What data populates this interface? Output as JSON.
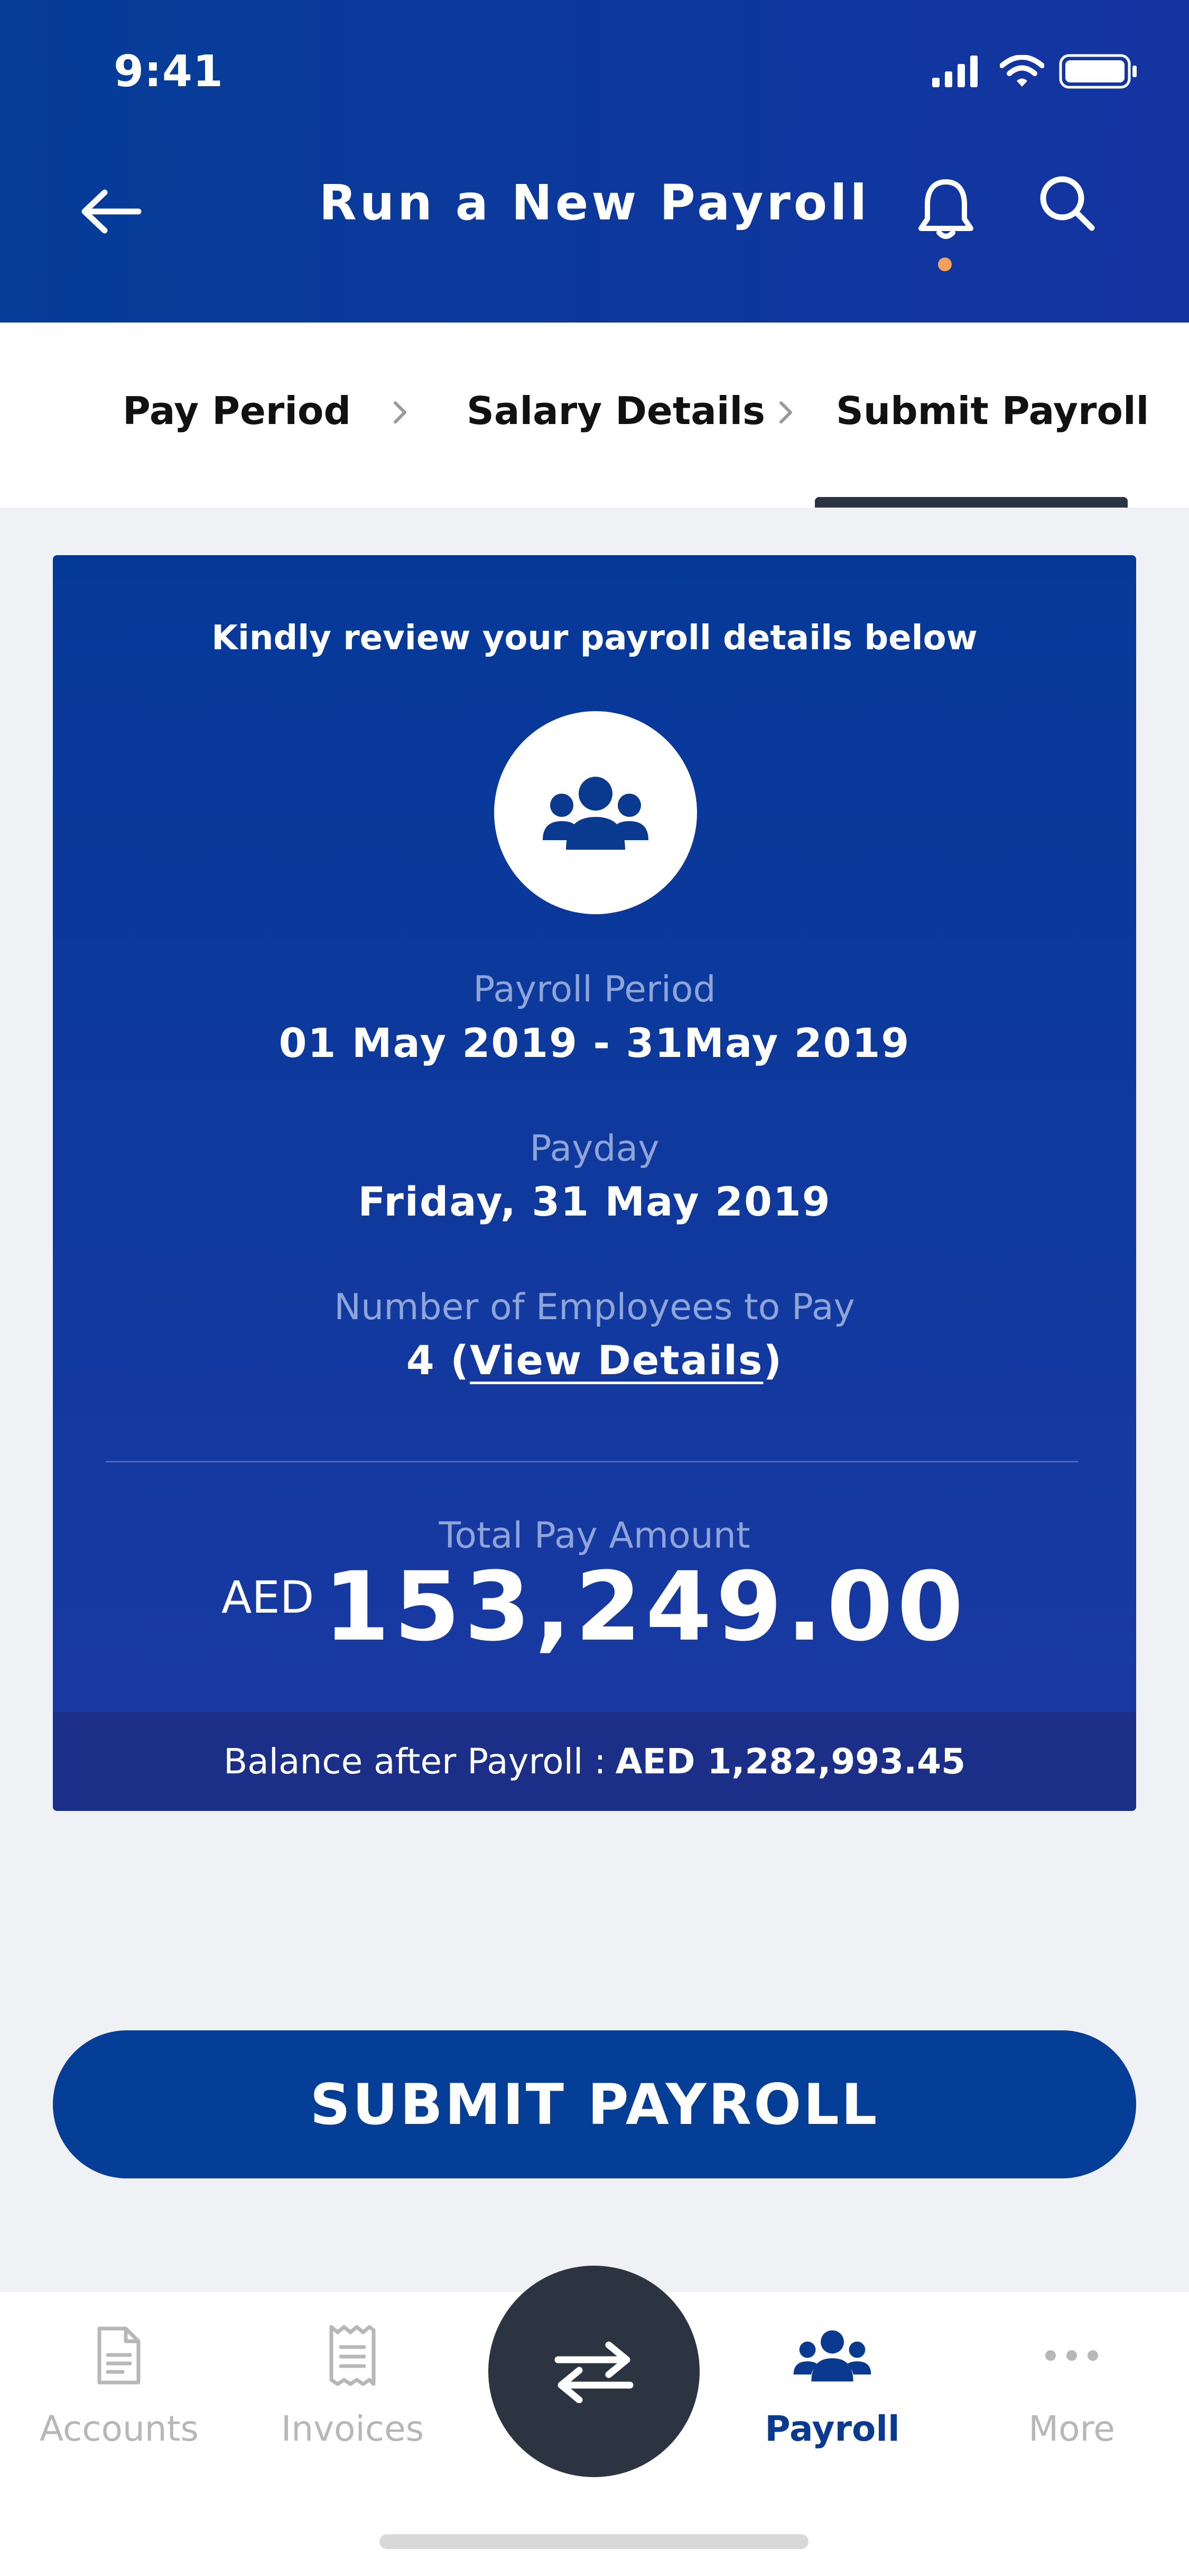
{
  "status_bar": {
    "time": "9:41"
  },
  "header": {
    "title": "Run a New Payroll"
  },
  "steps": [
    {
      "label": "Pay Period"
    },
    {
      "label": "Salary Details"
    },
    {
      "label": "Submit Payroll"
    }
  ],
  "card": {
    "intro": "Kindly review your payroll details below",
    "payroll_period_label": "Payroll Period",
    "payroll_period_value": "01 May 2019 - 31May 2019",
    "payday_label": "Payday",
    "payday_value": "Friday, 31 May 2019",
    "employees_label": "Number of Employees to Pay",
    "employees_count": "4",
    "employees_open": " (",
    "employees_link": "View Details",
    "employees_close": ")",
    "total_label": "Total Pay Amount",
    "total_currency": "AED",
    "total_value": "153,249.00",
    "balance_label": "Balance after Payroll :",
    "balance_value": "AED 1,282,993.45"
  },
  "submit_label": "SUBMIT PAYROLL",
  "tabbar": {
    "active": "Payroll",
    "items": [
      {
        "label": "Accounts",
        "icon": "document-icon"
      },
      {
        "label": "Invoices",
        "icon": "receipt-icon"
      },
      {
        "label": "Payroll",
        "icon": "people-icon"
      },
      {
        "label": "More",
        "icon": "more-dots-icon"
      }
    ]
  },
  "colors": {
    "header_start": "#053d98",
    "header_end": "#1434a2",
    "primary": "#053e96",
    "notification_dot": "#f5a05a",
    "fab": "#2b3440"
  }
}
